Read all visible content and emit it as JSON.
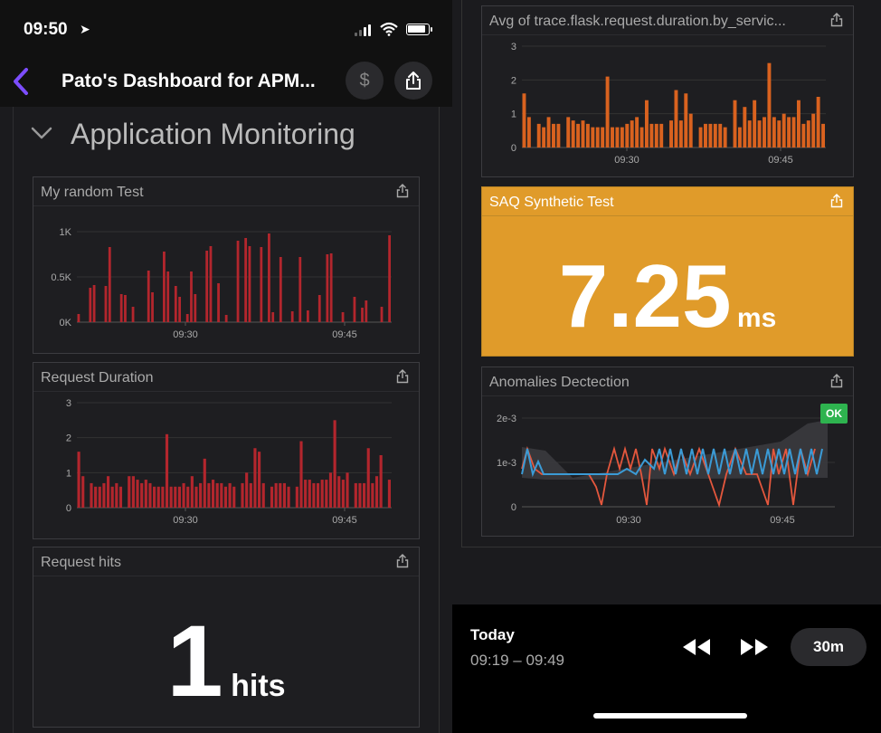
{
  "status_bar": {
    "time": "09:50"
  },
  "nav": {
    "title": "Pato's Dashboard for APM...",
    "cost_icon": "$"
  },
  "group": {
    "title": "Application Monitoring"
  },
  "widgets": {
    "random_test": {
      "title": "My random Test"
    },
    "request_duration": {
      "title": "Request Duration"
    },
    "request_hits": {
      "title": "Request hits",
      "value": "1",
      "unit": "hits"
    },
    "avg_trace": {
      "title": "Avg of trace.flask.request.duration.by_servic..."
    },
    "synthetic": {
      "title": "SAQ Synthetic Test",
      "value": "7.25",
      "unit": "ms"
    },
    "anomalies": {
      "title": "Anomalies Dectection",
      "badge": "OK"
    }
  },
  "time_control": {
    "label": "Today",
    "range": "09:19 – 09:49",
    "span": "30m"
  },
  "colors": {
    "accent": "#7c4dff",
    "bar": "#b3262d",
    "bar_orange": "#d9621f",
    "synthetic_bg": "#e09b2a",
    "line_blue": "#3b9bd6",
    "line_red": "#e4573d",
    "ok": "#2eb34f"
  },
  "icons": [
    "location-arrow-icon",
    "signal-icon",
    "wifi-icon",
    "battery-icon",
    "back-chevron-icon",
    "dollar-icon",
    "share-icon",
    "chevron-down-icon",
    "rewind-icon",
    "fast-forward-icon"
  ],
  "chart_data": [
    {
      "name": "My random Test",
      "type": "bar",
      "yticks": [
        "0K",
        "0.5K",
        "1K"
      ],
      "xticks": [
        "09:30",
        "09:45"
      ],
      "ylim": [
        0,
        1000
      ],
      "values": [
        90,
        0,
        0,
        380,
        410,
        0,
        0,
        400,
        830,
        0,
        0,
        310,
        300,
        0,
        170,
        0,
        0,
        0,
        570,
        330,
        0,
        0,
        780,
        560,
        0,
        400,
        280,
        0,
        90,
        560,
        310,
        0,
        0,
        790,
        840,
        0,
        430,
        0,
        80,
        0,
        0,
        900,
        0,
        930,
        840,
        0,
        0,
        830,
        0,
        980,
        110,
        0,
        720,
        0,
        0,
        120,
        0,
        720,
        0,
        130,
        0,
        0,
        300,
        0,
        750,
        760,
        0,
        0,
        110,
        0,
        0,
        280,
        0,
        160,
        240,
        0,
        0,
        0,
        170,
        0,
        960
      ]
    },
    {
      "name": "Request Duration",
      "type": "bar",
      "yticks": [
        "0",
        "1",
        "2",
        "3"
      ],
      "xticks": [
        "09:30",
        "09:45"
      ],
      "ylim": [
        0,
        3
      ],
      "values": [
        1.6,
        0.9,
        0,
        0.7,
        0.6,
        0.6,
        0.7,
        0.9,
        0.6,
        0.7,
        0.6,
        0,
        0.9,
        0.9,
        0.8,
        0.7,
        0.8,
        0.7,
        0.6,
        0.6,
        0.6,
        2.1,
        0.6,
        0.6,
        0.6,
        0.7,
        0.6,
        0.9,
        0.6,
        0.7,
        1.4,
        0.7,
        0.8,
        0.7,
        0.7,
        0.6,
        0.7,
        0.6,
        0,
        0.7,
        1.0,
        0.7,
        1.7,
        1.6,
        0.7,
        0,
        0.6,
        0.7,
        0.7,
        0.7,
        0.6,
        0,
        0.6,
        1.9,
        0.8,
        0.8,
        0.7,
        0.7,
        0.8,
        0.8,
        1.0,
        2.5,
        0.9,
        0.8,
        1.0,
        0,
        0.7,
        0.7,
        0.7,
        1.7,
        0.7,
        0.9,
        1.5,
        0,
        0.8
      ]
    },
    {
      "name": "Avg of trace.flask.request.duration.by_servic...",
      "type": "bar",
      "yticks": [
        "0",
        "1",
        "2",
        "3"
      ],
      "xticks": [
        "09:30",
        "09:45"
      ],
      "ylim": [
        0,
        3
      ],
      "values": [
        1.6,
        0.9,
        0,
        0.7,
        0.6,
        0.9,
        0.7,
        0.7,
        0,
        0.9,
        0.8,
        0.7,
        0.8,
        0.7,
        0.6,
        0.6,
        0.6,
        2.1,
        0.6,
        0.6,
        0.6,
        0.7,
        0.8,
        0.9,
        0.6,
        1.4,
        0.7,
        0.7,
        0.7,
        0,
        0.8,
        1.7,
        0.8,
        1.6,
        1.0,
        0,
        0.6,
        0.7,
        0.7,
        0.7,
        0.7,
        0.6,
        0,
        1.4,
        0.6,
        1.2,
        0.8,
        1.4,
        0.8,
        0.9,
        2.5,
        0.9,
        0.8,
        1.0,
        0.9,
        0.9,
        1.4,
        0.7,
        0.8,
        1.0,
        1.5,
        0.7
      ]
    },
    {
      "name": "Anomalies Dectection",
      "type": "line",
      "yticks": [
        "0",
        "1e-3",
        "2e-3"
      ],
      "xticks": [
        "09:30",
        "09:45"
      ],
      "ylim": [
        0,
        0.003
      ]
    }
  ]
}
